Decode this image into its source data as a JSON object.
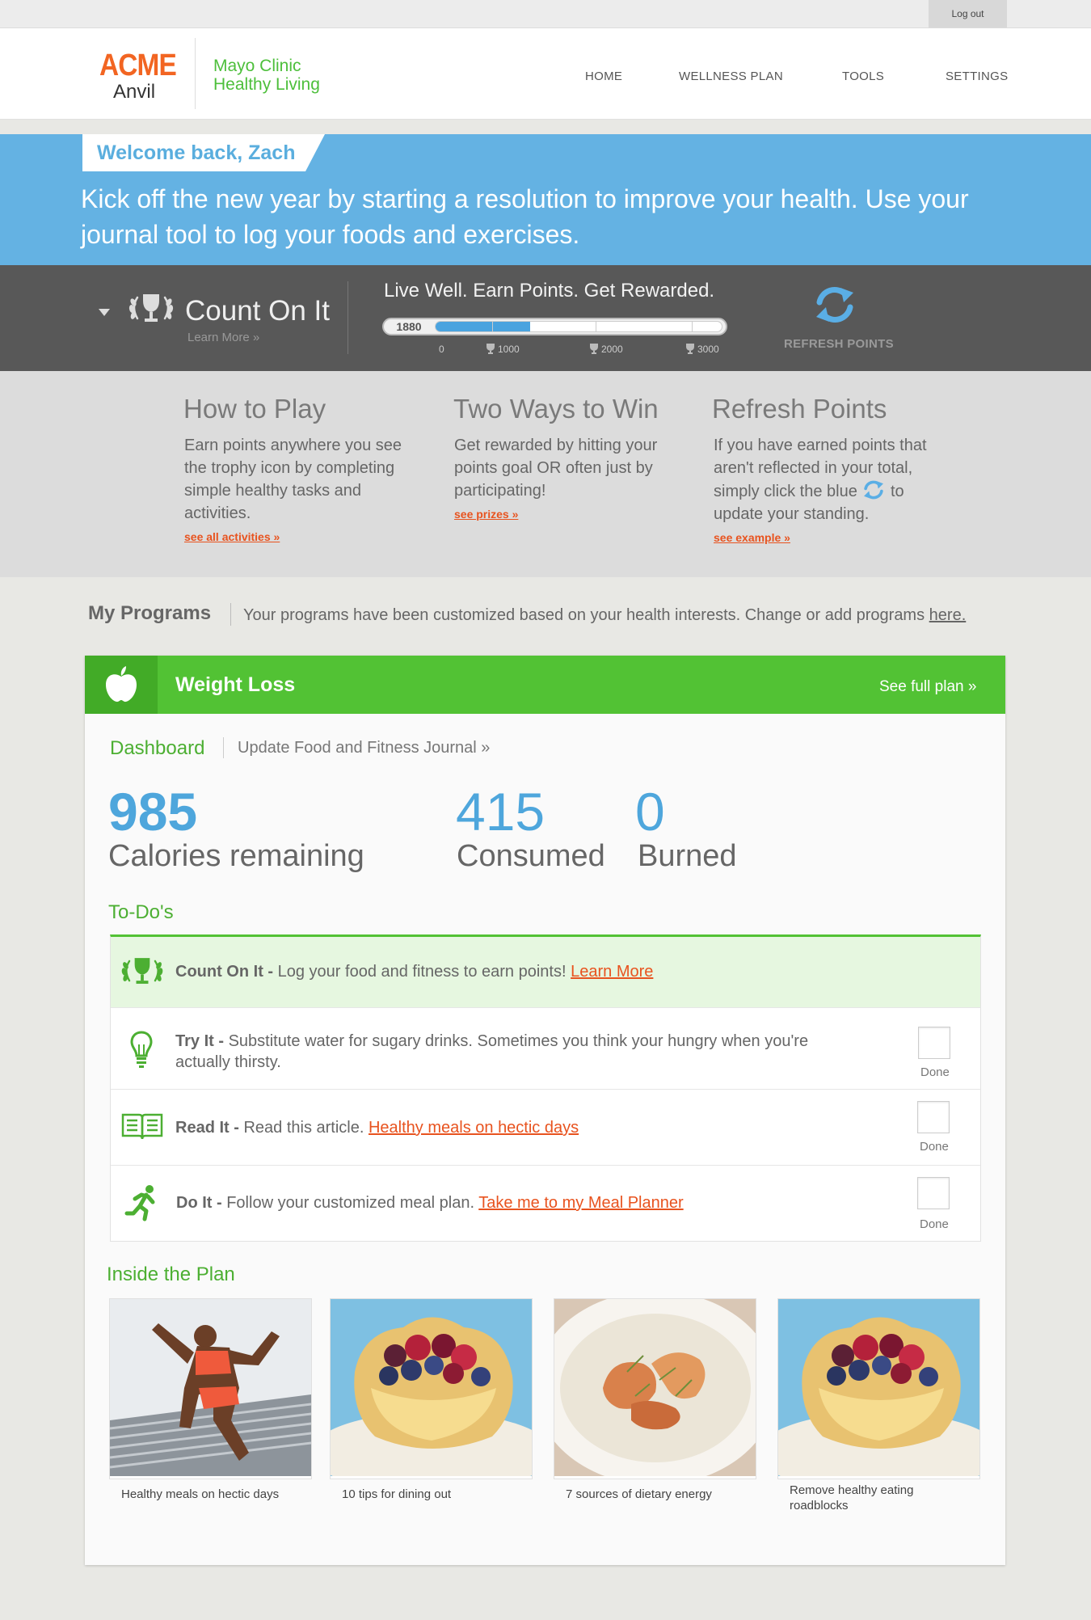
{
  "utility": {
    "logout": "Log out"
  },
  "brand": {
    "acme": "ACME",
    "anvil": "Anvil",
    "partner_line1": "Mayo Clinic",
    "partner_line2": "Healthy Living"
  },
  "nav": [
    "HOME",
    "WELLNESS PLAN",
    "TOOLS",
    "SETTINGS"
  ],
  "banner": {
    "welcome": "Welcome back, Zach",
    "message": "Kick off the new year by starting a resolution to improve your health. Use your journal tool to log your foods and exercises."
  },
  "points": {
    "title": "Count On It",
    "learn_more": "Learn More »",
    "tagline": "Live Well. Earn Points. Get Rewarded.",
    "current": "1880",
    "progress_fraction": 0.33,
    "ticks": [
      "0",
      "1000",
      "2000",
      "3000"
    ],
    "refresh_label": "REFRESH POINTS"
  },
  "info": [
    {
      "heading": "How to Play",
      "body": "Earn points anywhere you see the trophy icon by completing simple healthy tasks and activities.",
      "link": "see all activities »"
    },
    {
      "heading": "Two Ways to Win",
      "body": "Get rewarded by hitting your points goal OR often just by participating!",
      "link": "see prizes »"
    },
    {
      "heading": "Refresh Points",
      "body_before": "If you have earned points that aren't reflected in your total, simply click the blue",
      "body_after": "to update your standing.",
      "link": "see example »"
    }
  ],
  "programs": {
    "title": "My Programs",
    "desc": "Your programs have been customized based on your health interests. Change or add programs",
    "here": "here."
  },
  "program": {
    "name": "Weight Loss",
    "full_plan": "See full plan »",
    "tab_dashboard": "Dashboard",
    "tab_journal": "Update Food and Fitness Journal »",
    "calories_remaining": "985",
    "calories_remaining_label": "Calories remaining",
    "consumed": "415",
    "consumed_label": "Consumed",
    "burned": "0",
    "burned_label": "Burned"
  },
  "todos": {
    "title": "To-Do's",
    "done": "Done",
    "items": [
      {
        "bold": "Count On It -",
        "text": " Log your food and fitness to earn points! ",
        "link": "Learn More"
      },
      {
        "bold": "Try It -",
        "text": " Substitute water for sugary drinks. Sometimes you think your hungry when you're actually thirsty.",
        "link": ""
      },
      {
        "bold": "Read It -",
        "text": " Read this article. ",
        "link": "Healthy meals on hectic days"
      },
      {
        "bold": "Do It -",
        "text": " Follow your customized meal plan. ",
        "link": "Take me to my Meal Planner"
      }
    ]
  },
  "inside": {
    "title": "Inside the Plan",
    "tiles": [
      "Healthy meals on hectic days",
      "10 tips for dining out",
      "7 sources of dietary energy",
      "Remove healthy eating roadblocks"
    ]
  },
  "colors": {
    "green": "#52c234",
    "blue": "#64b2e3",
    "orange": "#e8531f",
    "dark": "#585858"
  }
}
